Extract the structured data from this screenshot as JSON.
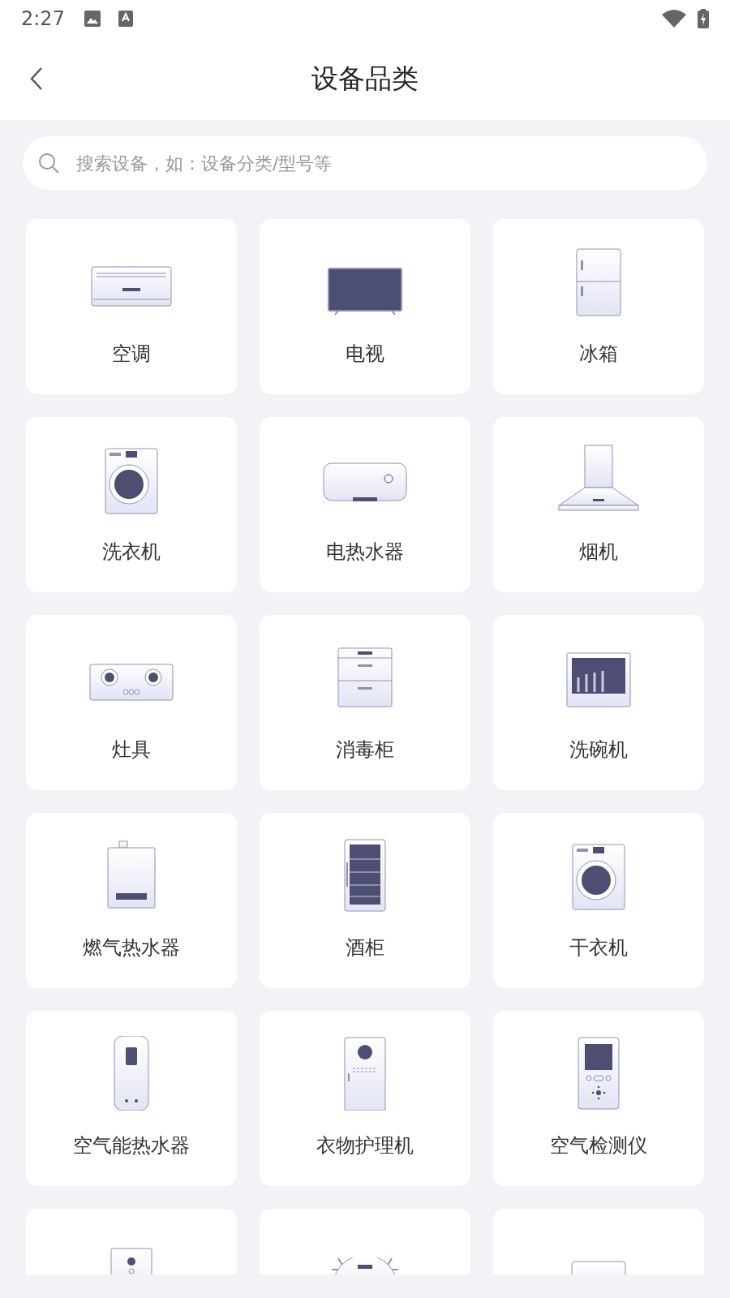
{
  "status_bar": {
    "time": "2:27"
  },
  "header": {
    "title": "设备品类"
  },
  "search": {
    "placeholder": "搜索设备，如：设备分类/型号等"
  },
  "categories": [
    {
      "label": "空调",
      "kind": "air_conditioner"
    },
    {
      "label": "电视",
      "kind": "tv"
    },
    {
      "label": "冰箱",
      "kind": "fridge"
    },
    {
      "label": "洗衣机",
      "kind": "washer"
    },
    {
      "label": "电热水器",
      "kind": "water_heater"
    },
    {
      "label": "烟机",
      "kind": "range_hood"
    },
    {
      "label": "灶具",
      "kind": "stove"
    },
    {
      "label": "消毒柜",
      "kind": "sterilizer"
    },
    {
      "label": "洗碗机",
      "kind": "dishwasher"
    },
    {
      "label": "燃气热水器",
      "kind": "gas_heater"
    },
    {
      "label": "酒柜",
      "kind": "wine_cabinet"
    },
    {
      "label": "干衣机",
      "kind": "dryer"
    },
    {
      "label": "空气能热水器",
      "kind": "heat_pump"
    },
    {
      "label": "衣物护理机",
      "kind": "clothes_care"
    },
    {
      "label": "空气检测仪",
      "kind": "air_monitor"
    },
    {
      "kind": "wall_panel"
    },
    {
      "kind": "robot_vacuum"
    },
    {
      "kind": "box_device"
    }
  ]
}
